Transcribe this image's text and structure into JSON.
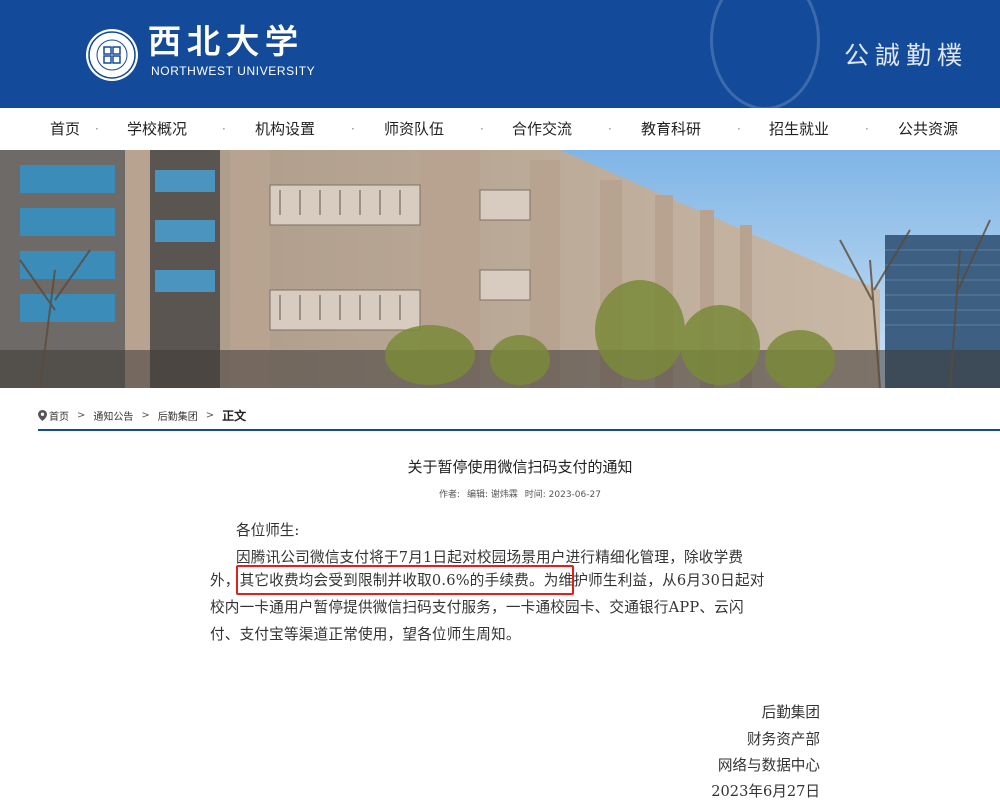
{
  "header": {
    "logo_cn": "西北大学",
    "logo_en": "NORTHWEST UNIVERSITY",
    "motto": "公誠勤樸"
  },
  "nav": {
    "items": [
      "首页",
      "学校概况",
      "机构设置",
      "师资队伍",
      "合作交流",
      "教育科研",
      "招生就业",
      "公共资源"
    ],
    "separator": "·"
  },
  "breadcrumb": {
    "items": [
      "首页",
      "通知公告",
      "后勤集团"
    ],
    "separator": ">",
    "current": "正文"
  },
  "article": {
    "title": "关于暂停使用微信扫码支付的通知",
    "meta": {
      "author_label": "作者:",
      "editor": "编辑: 谢炜霖",
      "time": "时间: 2023-06-27"
    },
    "greeting": "各位师生:",
    "lines": [
      "因腾讯公司微信支付将于7月1日起对校园场景用户进行精细化管理，除收学费",
      "外，其它收费均会受到限制并收取0.6%的手续费。为维护师生利益，从6月30日起对",
      "校内一卡通用户暂停提供微信扫码支付服务，一卡通校园卡、交通银行APP、云闪",
      "付、支付宝等渠道正常使用，望各位师生周知。"
    ],
    "signature": {
      "org1": "后勤集团",
      "org2": "财务资产部",
      "org3": "网络与数据中心",
      "date": "2023年6月27日"
    }
  },
  "colors": {
    "brand_blue": "#134a9a",
    "highlight_red": "#e0201c"
  }
}
